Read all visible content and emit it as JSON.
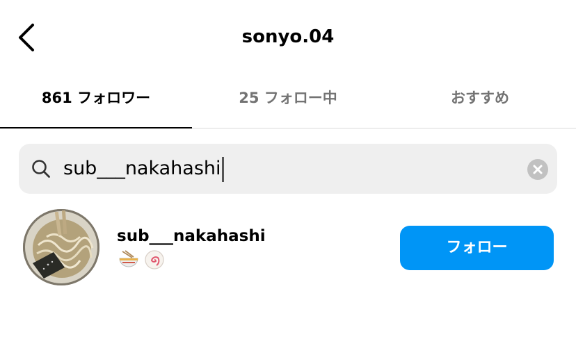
{
  "header": {
    "title": "sonyo.04",
    "back_icon": "chevron-left-icon"
  },
  "tabs": [
    {
      "label": "861 フォロワー",
      "active": true
    },
    {
      "label": "25 フォロー中",
      "active": false
    },
    {
      "label": "おすすめ",
      "active": false
    }
  ],
  "search": {
    "value": "sub___nakahashi",
    "icon": "search-icon",
    "clear_icon": "clear-icon"
  },
  "results": [
    {
      "username": "sub___nakahashi",
      "bio_icons": [
        "ramen-bowl-emoji",
        "fish-cake-emoji"
      ],
      "button_label": "フォロー"
    }
  ],
  "colors": {
    "accent": "#0095f6",
    "inactive_tab": "#737373",
    "search_bg": "#efefef"
  }
}
